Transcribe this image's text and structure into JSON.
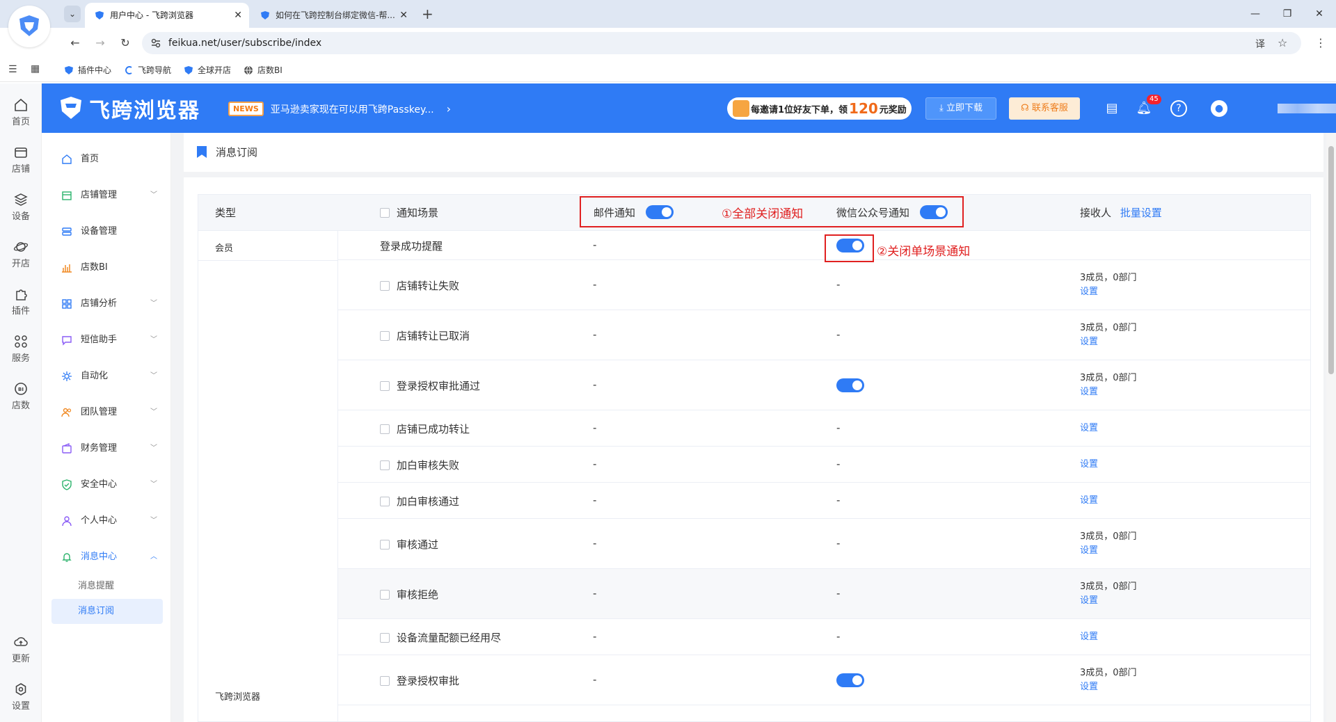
{
  "browser": {
    "tabs": [
      {
        "title": "用户中心 - 飞跨浏览器",
        "active": true
      },
      {
        "title": "如何在飞跨控制台绑定微信-帮...",
        "active": false
      }
    ],
    "url": "feikua.net/user/subscribe/index",
    "bookmarks": [
      "插件中心",
      "飞跨导航",
      "全球开店",
      "店数BI"
    ]
  },
  "header": {
    "brand": "飞跨浏览器",
    "news_badge": "NEWS",
    "news_text": "亚马逊卖家现在可以用飞跨Passkey...",
    "invite_pre": "每邀请1位好友下单，领",
    "invite_amount": "120",
    "invite_post": "元奖励",
    "download_label": "立即下载",
    "service_label": "联系客服",
    "notification_count": "45"
  },
  "rail": [
    "首页",
    "店铺",
    "设备",
    "开店",
    "插件",
    "服务",
    "店数",
    "更新",
    "设置"
  ],
  "sidebar": {
    "items": [
      "首页",
      "店铺管理",
      "设备管理",
      "店数BI",
      "店铺分析",
      "短信助手",
      "自动化",
      "团队管理",
      "财务管理",
      "安全中心",
      "个人中心",
      "消息中心"
    ],
    "sub_items": [
      "消息提醒",
      "消息订阅"
    ]
  },
  "page": {
    "title": "消息订阅"
  },
  "table": {
    "headers": {
      "type": "类型",
      "scene": "通知场景",
      "email": "邮件通知",
      "wechat": "微信公众号通知",
      "receiver": "接收人",
      "batch": "批量设置"
    },
    "groups": [
      "会员",
      "飞跨浏览器"
    ],
    "rows": [
      {
        "scene": "登录成功提醒",
        "email": "-",
        "wechat_on": true,
        "members": "",
        "setting": ""
      },
      {
        "scene": "店铺转让失败",
        "email": "-",
        "wechat": "-",
        "members": "3成员，0部门",
        "setting": "设置"
      },
      {
        "scene": "店铺转让已取消",
        "email": "-",
        "wechat": "-",
        "members": "3成员，0部门",
        "setting": "设置"
      },
      {
        "scene": "登录授权审批通过",
        "email": "-",
        "wechat_on": true,
        "members": "3成员，0部门",
        "setting": "设置"
      },
      {
        "scene": "店铺已成功转让",
        "email": "-",
        "wechat": "-",
        "members": "",
        "setting": "设置"
      },
      {
        "scene": "加白审核失败",
        "email": "-",
        "wechat": "-",
        "members": "",
        "setting": "设置"
      },
      {
        "scene": "加白审核通过",
        "email": "-",
        "wechat": "-",
        "members": "",
        "setting": "设置"
      },
      {
        "scene": "审核通过",
        "email": "-",
        "wechat": "-",
        "members": "3成员，0部门",
        "setting": "设置"
      },
      {
        "scene": "审核拒绝",
        "email": "-",
        "wechat": "-",
        "members": "3成员，0部门",
        "setting": "设置"
      },
      {
        "scene": "设备流量配额已经用尽",
        "email": "-",
        "wechat": "-",
        "members": "",
        "setting": "设置"
      },
      {
        "scene": "登录授权审批",
        "email": "-",
        "wechat_on": true,
        "members": "3成员，0部门",
        "setting": "设置"
      }
    ]
  },
  "annotations": {
    "all_off": "①全部关闭通知",
    "single_off": "②关闭单场景通知"
  },
  "colors": {
    "primary": "#2f7bf5",
    "annotation": "#e02020",
    "service": "#ee7d1c"
  }
}
